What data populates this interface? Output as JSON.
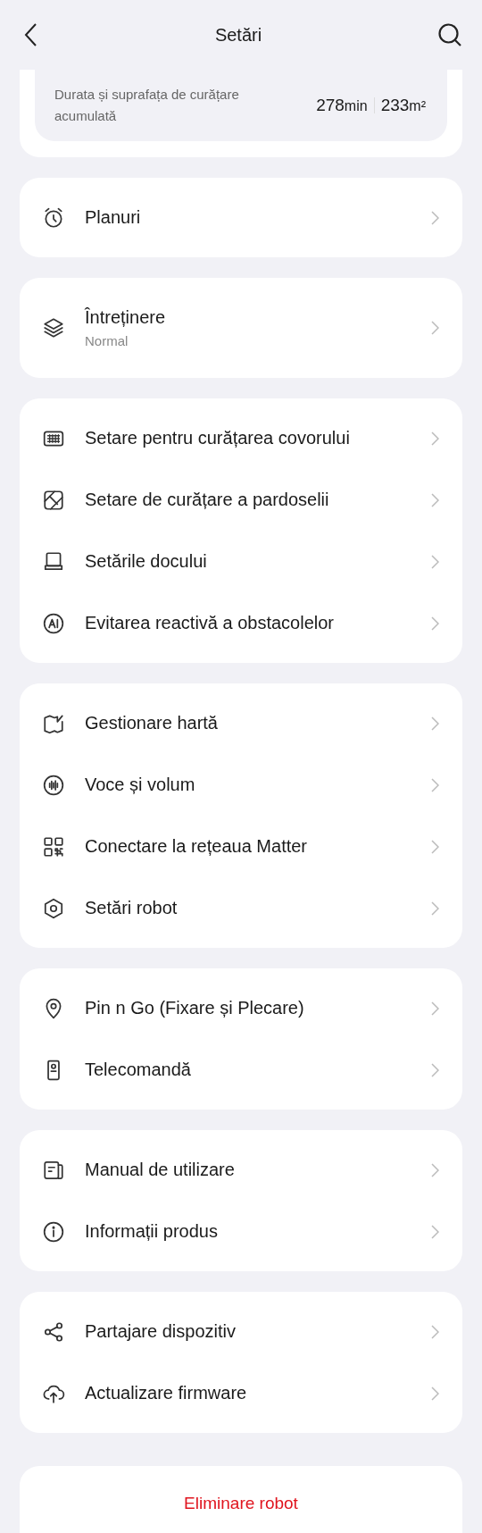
{
  "header": {
    "title": "Setări"
  },
  "stats": {
    "label": "Durata și suprafața de curățare acumulată",
    "duration_value": "278",
    "duration_unit": "min",
    "area_value": "233",
    "area_unit": "m²"
  },
  "groups": [
    {
      "items": [
        {
          "kind": "alarm",
          "label": "Planuri"
        }
      ]
    },
    {
      "items": [
        {
          "kind": "layers",
          "label": "Întreținere",
          "subtitle": "Normal"
        }
      ]
    },
    {
      "items": [
        {
          "kind": "carpet",
          "label": "Setare pentru curățarea covorului"
        },
        {
          "kind": "floor",
          "label": "Setare de curățare a pardoselii"
        },
        {
          "kind": "dock",
          "label": "Setările docului"
        },
        {
          "kind": "ai",
          "label": "Evitarea reactivă a obstacolelor"
        }
      ]
    },
    {
      "items": [
        {
          "kind": "map",
          "label": "Gestionare hartă"
        },
        {
          "kind": "voice",
          "label": "Voce și volum"
        },
        {
          "kind": "qr",
          "label": "Conectare la rețeaua Matter"
        },
        {
          "kind": "hexagon",
          "label": "Setări robot"
        }
      ]
    },
    {
      "items": [
        {
          "kind": "pin",
          "label": "Pin n Go (Fixare și Plecare)"
        },
        {
          "kind": "remote",
          "label": "Telecomandă"
        }
      ]
    },
    {
      "items": [
        {
          "kind": "manual",
          "label": "Manual de utilizare"
        },
        {
          "kind": "info",
          "label": "Informații produs"
        }
      ]
    },
    {
      "items": [
        {
          "kind": "share",
          "label": "Partajare dispozitiv"
        },
        {
          "kind": "upload",
          "label": "Actualizare firmware"
        }
      ]
    }
  ],
  "delete_button": {
    "label": "Eliminare robot"
  }
}
